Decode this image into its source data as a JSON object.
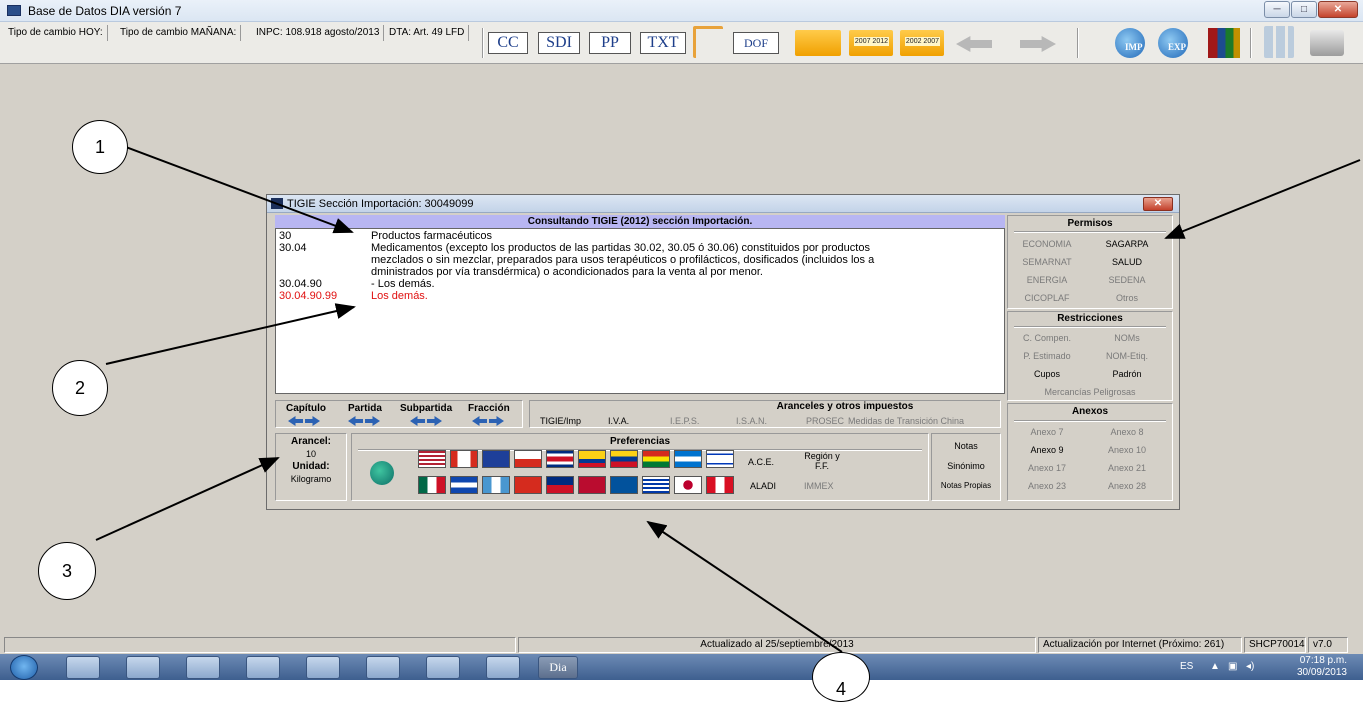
{
  "app": {
    "title": "Base de Datos DIA versión 7"
  },
  "window_buttons": {
    "minimize": "─",
    "maximize": "□",
    "close": "✕"
  },
  "toolbar": {
    "tipo_hoy": "Tipo de cambio HOY:",
    "tipo_manana": "Tipo de cambio MAÑANA:",
    "inpc": "INPC: 108.918 agosto/2013",
    "dta": "DTA: Art. 49 LFD",
    "btn_cc": "CC",
    "btn_sdi": "SDI",
    "btn_pp": "PP",
    "btn_txt": "TXT",
    "btn_dof": "DOF",
    "folder_2007_2012": "2007 2012",
    "folder_2002_2007": "2002 2007",
    "btn_imp": "IMP",
    "btn_exp": "EXP"
  },
  "annotations": {
    "n1": "1",
    "n2": "2",
    "n3": "3",
    "n4": "4"
  },
  "dialog": {
    "title": "TIGIE Sección Importación: 30049099",
    "close": "✕",
    "header": "Consultando TIGIE (2012) sección Importación.",
    "rows": [
      {
        "code": "30",
        "lines": [
          "Productos farmacéuticos"
        ]
      },
      {
        "code": "30.04",
        "lines": [
          "Medicamentos (excepto los productos de las partidas 30.02, 30.05 ó 30.06) constituidos por productos",
          "mezclados o sin mezclar, preparados para usos terapéuticos o profilácticos, dosificados (incluidos los a",
          "dministrados por vía transdérmica) o acondicionados para la venta al por menor."
        ]
      },
      {
        "code": "30.04.90",
        "lines": [
          "- Los demás."
        ]
      },
      {
        "code": "30.04.90.99",
        "lines": [
          "Los demás."
        ]
      }
    ],
    "nav": {
      "capitulo": "Capítulo",
      "partida": "Partida",
      "subpartida": "Subpartida",
      "fraccion": "Fracción"
    },
    "aranceles": {
      "title": "Aranceles y otros impuestos",
      "items": [
        "TIGIE/Imp",
        "I.V.A.",
        "I.E.P.S.",
        "I.S.A.N.",
        "PROSEC",
        "Medidas de Transición China"
      ]
    },
    "arancel": {
      "label": "Arancel:",
      "value": "10",
      "unit_label": "Unidad:",
      "unit_value": "Kilogramo"
    },
    "preferencias": {
      "title": "Preferencias",
      "ace": "A.C.E.",
      "region": "Región y F.F.",
      "aladi": "ALADI",
      "immex": "IMMEX"
    },
    "notas": {
      "notas": "Notas",
      "sinonimo": "Sinónimo",
      "propias": "Notas Propias"
    },
    "permisos": {
      "title": "Permisos",
      "items": [
        "ECONOMIA",
        "SAGARPA",
        "SEMARNAT",
        "SALUD",
        "ENERGIA",
        "SEDENA",
        "CICOPLAF",
        "Otros"
      ],
      "active": [
        false,
        true,
        false,
        true,
        false,
        false,
        false,
        false
      ]
    },
    "restricciones": {
      "title": "Restricciones",
      "items": [
        "C. Compen.",
        "NOMs",
        "P. Estimado",
        "NOM-Etiq.",
        "Cupos",
        "Padrón"
      ],
      "active": [
        false,
        false,
        false,
        false,
        true,
        true
      ],
      "extra": "Mercancías Peligrosas"
    },
    "anexos": {
      "title": "Anexos",
      "items": [
        "Anexo 7",
        "Anexo 8",
        "Anexo 9",
        "Anexo 10",
        "Anexo 17",
        "Anexo 21",
        "Anexo 23",
        "Anexo 28"
      ],
      "active": [
        false,
        false,
        true,
        false,
        false,
        false,
        false,
        false
      ]
    }
  },
  "status": {
    "updated": "Actualizado al 25/septiembre/2013",
    "internet": "Actualización por Internet (Próximo: 261)",
    "rfc": "SHCP700148",
    "version": "v7.0"
  },
  "taskbar": {
    "dia": "Dia",
    "lang": "ES",
    "time": "07:18 p.m.",
    "date": "30/09/2013"
  },
  "colors": {
    "header_bg": "#b8b6f2",
    "red_row": "#e01010",
    "arrow_blue": "#2c62b3"
  }
}
